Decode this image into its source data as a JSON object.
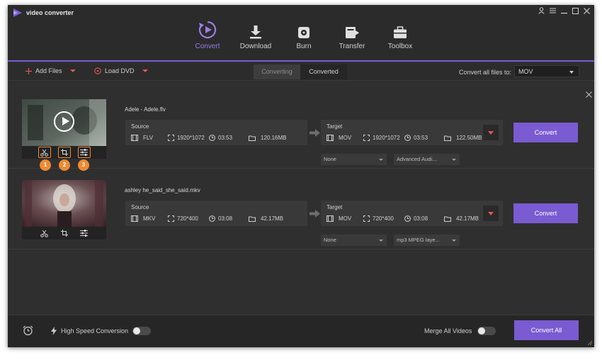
{
  "app": {
    "title": "video converter"
  },
  "window_controls": [
    "user-icon",
    "menu-icon",
    "minimize-icon",
    "maximize-icon",
    "close-icon"
  ],
  "nav": {
    "items": [
      {
        "label": "Convert",
        "icon": "convert-icon",
        "active": true
      },
      {
        "label": "Download",
        "icon": "download-icon",
        "active": false
      },
      {
        "label": "Burn",
        "icon": "burn-icon",
        "active": false
      },
      {
        "label": "Transfer",
        "icon": "transfer-icon",
        "active": false
      },
      {
        "label": "Toolbox",
        "icon": "toolbox-icon",
        "active": false
      }
    ]
  },
  "toolbar": {
    "add_files": "Add Files",
    "load_dvd": "Load DVD",
    "tabs": {
      "converting": "Converting",
      "converted": "Converted"
    },
    "convert_all_label": "Convert all files to:",
    "format": "MOV"
  },
  "files": [
    {
      "name": "Adele - Adele.flv",
      "source": {
        "label": "Source",
        "format": "FLV",
        "resolution": "1920*1072",
        "duration": "03:53",
        "size": "120.16MB"
      },
      "target": {
        "label": "Target",
        "format": "MOV",
        "resolution": "1920*1072",
        "duration": "03:53",
        "size": "122.50MB"
      },
      "subtitle": "None",
      "audio": "Advanced Audi...",
      "convert_label": "Convert",
      "badges": [
        "1",
        "2",
        "3"
      ]
    },
    {
      "name": "ashley he_said_she_said.mkv",
      "source": {
        "label": "Source",
        "format": "MKV",
        "resolution": "720*400",
        "duration": "03:08",
        "size": "42.17MB"
      },
      "target": {
        "label": "Target",
        "format": "MOV",
        "resolution": "720*400",
        "duration": "03:08",
        "size": "42.17MB"
      },
      "subtitle": "None",
      "audio": "mp3 MPEG laye...",
      "convert_label": "Convert"
    }
  ],
  "footer": {
    "high_speed": "High Speed Conversion",
    "merge": "Merge All Videos",
    "convert_all": "Convert All"
  },
  "colors": {
    "accent": "#7a5bd1",
    "highlight": "#ee8a33",
    "caret": "#e0574f",
    "background": "#2f2f2f"
  }
}
